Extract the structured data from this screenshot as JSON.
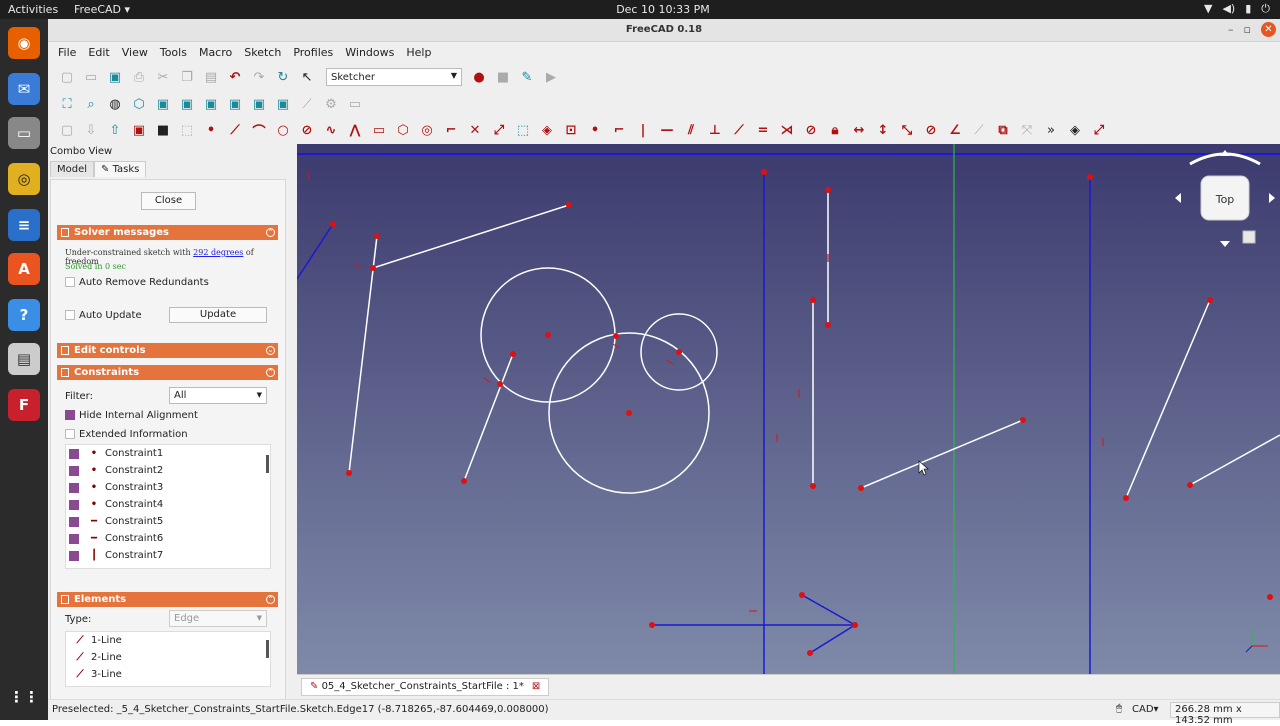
{
  "topbar": {
    "activities": "Activities",
    "app": "FreeCAD ▾",
    "clock": "Dec 10  10:33 PM"
  },
  "window": {
    "title": "FreeCAD 0.18"
  },
  "menu": [
    "File",
    "Edit",
    "View",
    "Tools",
    "Macro",
    "Sketch",
    "Profiles",
    "Windows",
    "Help"
  ],
  "workbench": "Sketcher",
  "combo": {
    "title": "Combo View",
    "tabs": [
      "Model",
      "Tasks"
    ],
    "close": "Close"
  },
  "solver": {
    "title": "Solver messages",
    "line1_a": "Under-constrained sketch with ",
    "line1_link": "292 degrees",
    "line1_b": " of freedom",
    "line2": "Solved in 0 sec",
    "auto_remove": "Auto Remove Redundants",
    "auto_update": "Auto Update",
    "update_btn": "Update"
  },
  "edit_controls": {
    "title": "Edit controls"
  },
  "constraints": {
    "title": "Constraints",
    "filter_label": "Filter:",
    "filter_value": "All",
    "hide_internal": "Hide Internal Alignment",
    "extended": "Extended Information",
    "items": [
      {
        "label": "Constraint1",
        "icon": "point-icon"
      },
      {
        "label": "Constraint2",
        "icon": "point-icon"
      },
      {
        "label": "Constraint3",
        "icon": "point-icon"
      },
      {
        "label": "Constraint4",
        "icon": "point-icon"
      },
      {
        "label": "Constraint5",
        "icon": "horizontal-icon"
      },
      {
        "label": "Constraint6",
        "icon": "horizontal-icon"
      },
      {
        "label": "Constraint7",
        "icon": "vertical-icon"
      }
    ]
  },
  "elements": {
    "title": "Elements",
    "type_label": "Type:",
    "type_value": "Edge",
    "items": [
      "1-Line",
      "2-Line",
      "3-Line"
    ]
  },
  "navcube": {
    "face": "Top"
  },
  "doc_tab": "05_4_Sketcher_Constraints_StartFile : 1*",
  "status": {
    "preselected": "Preselected: _5_4_Sketcher_Constraints_StartFile.Sketch.Edge17 (-8.718265,-87.604469,0.008000)",
    "nav": "CAD▾",
    "dims": "266.28 mm x 143.52 mm"
  }
}
